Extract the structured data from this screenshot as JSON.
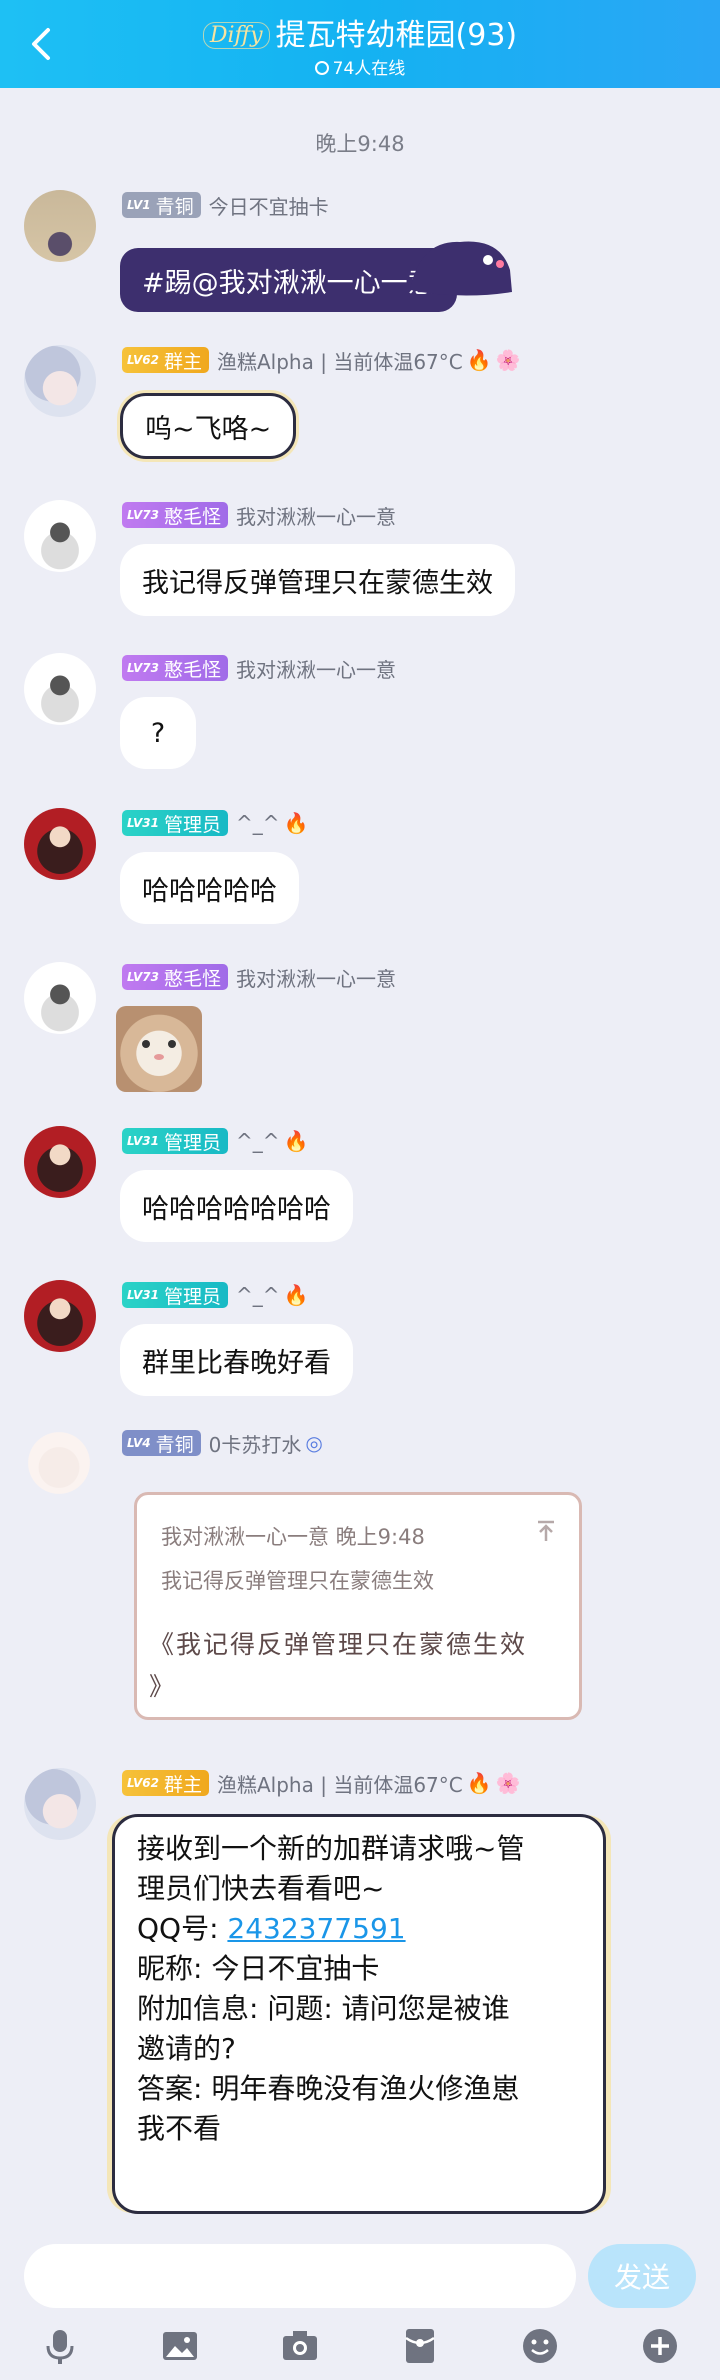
{
  "header": {
    "logo": "Diffy",
    "title": "提瓦特幼稚园(93)",
    "online": "74人在线"
  },
  "time": "晚上9:48",
  "messages": [
    {
      "level": "LV1",
      "rank": "青铜",
      "name": "今日不宜抽卡",
      "text": "#踢@我对湫湫一心一意"
    },
    {
      "level": "LV62",
      "rank": "群主",
      "name": "渔糕Alpha | 当前体温67°C",
      "text": "呜~飞咯~"
    },
    {
      "level": "LV73",
      "rank": "憨毛怪",
      "name": "我对湫湫一心一意",
      "text": "我记得反弹管理只在蒙德生效"
    },
    {
      "level": "LV73",
      "rank": "憨毛怪",
      "name": "我对湫湫一心一意",
      "text": "?"
    },
    {
      "level": "LV31",
      "rank": "管理员",
      "name": "^_^",
      "text": "哈哈哈哈哈"
    },
    {
      "level": "LV73",
      "rank": "憨毛怪",
      "name": "我对湫湫一心一意",
      "text": ""
    },
    {
      "level": "LV31",
      "rank": "管理员",
      "name": "^_^",
      "text": "哈哈哈哈哈哈哈"
    },
    {
      "level": "LV31",
      "rank": "管理员",
      "name": "^_^",
      "text": "群里比春晚好看"
    },
    {
      "level": "LV4",
      "rank": "青铜",
      "name": "0卡苏打水",
      "quote_header": "我对湫湫一心一意 晚上9:48",
      "quote_text": "我记得反弹管理只在蒙德生效",
      "text_line1": "《我记得反弹管理只在蒙德生效",
      "text_line2": "》"
    },
    {
      "level": "LV62",
      "rank": "群主",
      "name": "渔糕Alpha | 当前体温67°C",
      "line1": "接收到一个新的加群请求哦~管",
      "line2": "理员们快去看看吧~",
      "qq_label": "QQ号: ",
      "qq": "2432377591",
      "line4": "昵称: 今日不宜抽卡",
      "line5": "附加信息: 问题: 请问您是被谁",
      "line6": "邀请的?",
      "line7": "答案: 明年春晚没有渔火修渔崽",
      "line8": "我不看"
    }
  ],
  "input": {
    "send": "发送"
  },
  "colors": {
    "header": "#14b2f2",
    "background": "#edeef6",
    "link": "#1a96e8"
  }
}
